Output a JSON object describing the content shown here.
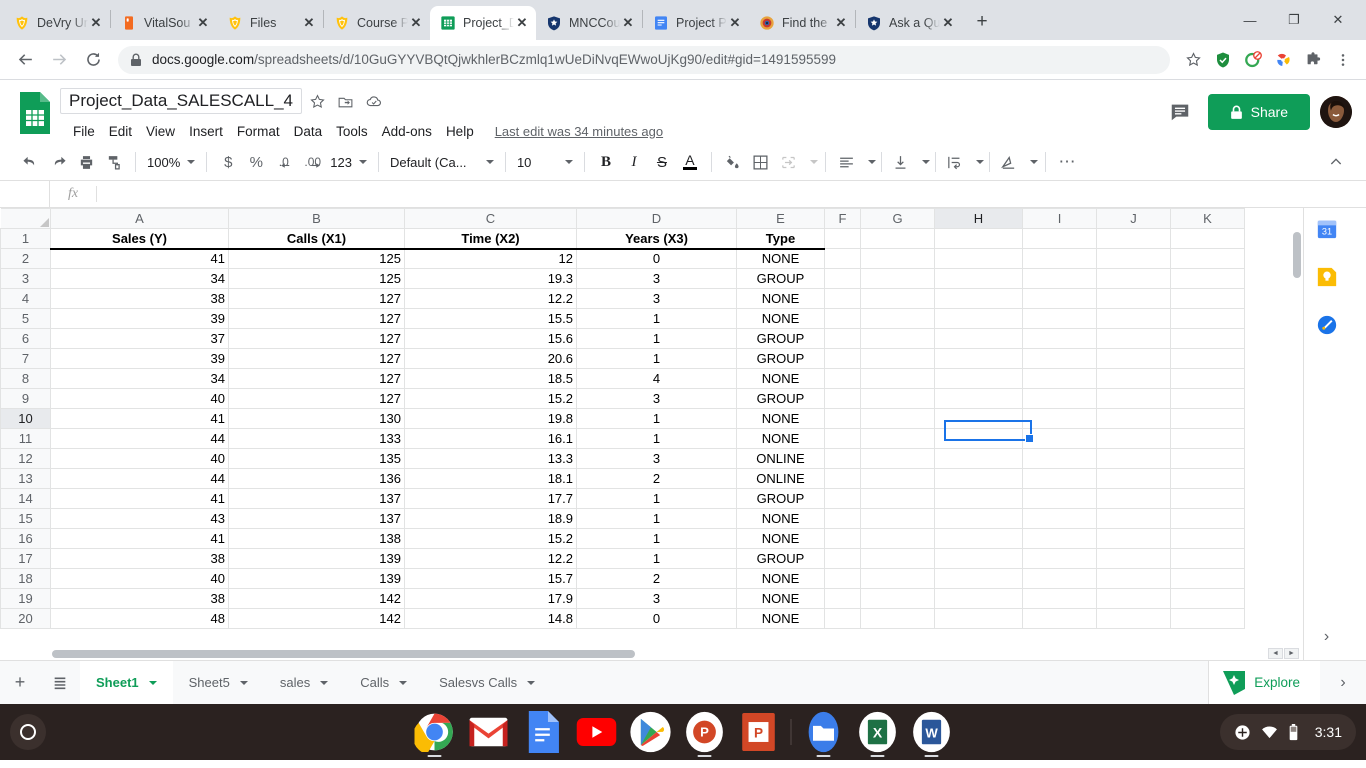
{
  "browser": {
    "tabs": [
      {
        "label": "DeVry Un",
        "icon": "devry-icon",
        "active": false,
        "sep_after": true
      },
      {
        "label": "VitalSou",
        "icon": "vitalsource-icon",
        "active": false,
        "sep_after": false
      },
      {
        "label": "Files",
        "icon": "devry-icon",
        "active": false,
        "sep_after": true
      },
      {
        "label": "Course P",
        "icon": "devry-icon",
        "active": false,
        "sep_after": false
      },
      {
        "label": "Project_D",
        "icon": "sheets-icon",
        "active": true,
        "sep_after": false
      },
      {
        "label": "MNCCou",
        "icon": "shield-icon",
        "active": false,
        "sep_after": true
      },
      {
        "label": "Project P",
        "icon": "docs-icon",
        "active": false,
        "sep_after": false
      },
      {
        "label": "Find the",
        "icon": "globe-icon",
        "active": false,
        "sep_after": true
      },
      {
        "label": "Ask a Qu",
        "icon": "shield-icon",
        "active": false,
        "sep_after": false
      }
    ],
    "new_tab_label": "+",
    "close_label": "✕",
    "window_controls": {
      "minimize": "—",
      "maximize": "❐",
      "close": "✕"
    },
    "nav": {
      "back": "←",
      "forward": "→",
      "reload": "⟳"
    },
    "url_host": "docs.google.com",
    "url_path": "/spreadsheets/d/10GuGYYVBQtQjwkhlerBCzmlq1wUeDiNvqEWwoUjKg90/edit#gid=1491595599",
    "lock_icon": "lock-icon",
    "star_icon": "bookmark-star-icon",
    "extensions": [
      "shield-check-icon",
      "adblock-icon",
      "pinwheel-icon",
      "puzzle-piece-icon"
    ],
    "menu_icon": "three-dot-menu-icon"
  },
  "sheets": {
    "doc_title": "Project_Data_SALESCALL_4",
    "title_icons": [
      "star-icon",
      "move-to-folder-icon",
      "cloud-saved-icon"
    ],
    "menus": [
      "File",
      "Edit",
      "View",
      "Insert",
      "Format",
      "Data",
      "Tools",
      "Add-ons",
      "Help"
    ],
    "last_edit": "Last edit was 34 minutes ago",
    "comment_icon": "comment-history-icon",
    "share_label": "Share",
    "share_lock_icon": "lock-icon",
    "share_color": "#0f9d58",
    "avatar": "user-avatar",
    "toolbar": {
      "undo": "undo-icon",
      "redo": "redo-icon",
      "print": "print-icon",
      "paint_format": "paint-format-icon",
      "zoom": "100%",
      "currency": "$",
      "percent": "%",
      "decrease_decimal": ".0",
      "increase_decimal": ".00",
      "more_formats": "123",
      "font": "Default (Ca...",
      "font_size": "10",
      "bold": "B",
      "italic": "I",
      "strikethrough": "S",
      "text_color": "A",
      "fill_color": "fill-color-icon",
      "borders": "borders-icon",
      "merge_cells": "merge-cells-icon",
      "h_align": "horizontal-align-icon",
      "v_align": "vertical-align-icon",
      "text_wrap": "text-wrap-icon",
      "text_rotation": "text-rotation-icon",
      "more": "⋯",
      "collapse": "^"
    },
    "formula_bar": {
      "fx": "fx",
      "value": ""
    },
    "selected_cell": "H10",
    "columns": [
      "A",
      "B",
      "C",
      "D",
      "E",
      "F",
      "G",
      "H",
      "I",
      "J",
      "K"
    ],
    "header_row": [
      "Sales (Y)",
      "Calls (X1)",
      "Time (X2)",
      "Years (X3)",
      "Type"
    ],
    "rows": [
      {
        "n": "2",
        "cells": [
          "41",
          "125",
          "12",
          "0",
          "NONE"
        ]
      },
      {
        "n": "3",
        "cells": [
          "34",
          "125",
          "19.3",
          "3",
          "GROUP"
        ]
      },
      {
        "n": "4",
        "cells": [
          "38",
          "127",
          "12.2",
          "3",
          "NONE"
        ]
      },
      {
        "n": "5",
        "cells": [
          "39",
          "127",
          "15.5",
          "1",
          "NONE"
        ]
      },
      {
        "n": "6",
        "cells": [
          "37",
          "127",
          "15.6",
          "1",
          "GROUP"
        ]
      },
      {
        "n": "7",
        "cells": [
          "39",
          "127",
          "20.6",
          "1",
          "GROUP"
        ]
      },
      {
        "n": "8",
        "cells": [
          "34",
          "127",
          "18.5",
          "4",
          "NONE"
        ]
      },
      {
        "n": "9",
        "cells": [
          "40",
          "127",
          "15.2",
          "3",
          "GROUP"
        ]
      },
      {
        "n": "10",
        "cells": [
          "41",
          "130",
          "19.8",
          "1",
          "NONE"
        ]
      },
      {
        "n": "11",
        "cells": [
          "44",
          "133",
          "16.1",
          "1",
          "NONE"
        ]
      },
      {
        "n": "12",
        "cells": [
          "40",
          "135",
          "13.3",
          "3",
          "ONLINE"
        ]
      },
      {
        "n": "13",
        "cells": [
          "44",
          "136",
          "18.1",
          "2",
          "ONLINE"
        ]
      },
      {
        "n": "14",
        "cells": [
          "41",
          "137",
          "17.7",
          "1",
          "GROUP"
        ]
      },
      {
        "n": "15",
        "cells": [
          "43",
          "137",
          "18.9",
          "1",
          "NONE"
        ]
      },
      {
        "n": "16",
        "cells": [
          "41",
          "138",
          "15.2",
          "1",
          "NONE"
        ]
      },
      {
        "n": "17",
        "cells": [
          "38",
          "139",
          "12.2",
          "1",
          "GROUP"
        ]
      },
      {
        "n": "18",
        "cells": [
          "40",
          "139",
          "15.7",
          "2",
          "NONE"
        ]
      },
      {
        "n": "19",
        "cells": [
          "38",
          "142",
          "17.9",
          "3",
          "NONE"
        ]
      },
      {
        "n": "20",
        "cells": [
          "48",
          "142",
          "14.8",
          "0",
          "NONE"
        ]
      }
    ],
    "side_rail": [
      "calendar-icon",
      "keep-icon",
      "tasks-icon"
    ],
    "side_rail_expand": "›",
    "sheet_tabs": [
      {
        "label": "Sheet1",
        "active": true
      },
      {
        "label": "Sheet5",
        "active": false
      },
      {
        "label": "sales",
        "active": false
      },
      {
        "label": "Calls",
        "active": false
      },
      {
        "label": "Salesvs Calls",
        "active": false
      }
    ],
    "add_sheet": "+",
    "all_sheets": "all-sheets-icon",
    "explore_label": "Explore",
    "explore_icon": "explore-icon",
    "bottom_chevron": "›",
    "hscroll_left": "◄",
    "hscroll_right": "►"
  },
  "shelf": {
    "launcher": "launcher-icon",
    "apps": [
      {
        "name": "chrome-icon",
        "running": true
      },
      {
        "name": "gmail-icon",
        "running": false
      },
      {
        "name": "docs-icon",
        "running": false
      },
      {
        "name": "youtube-icon",
        "running": false
      },
      {
        "name": "play-store-icon",
        "running": false
      },
      {
        "name": "powerpoint-web-icon",
        "running": true
      },
      {
        "name": "powerpoint-icon",
        "running": false
      },
      {
        "name": "files-icon",
        "running": true
      },
      {
        "name": "excel-icon",
        "running": true
      },
      {
        "name": "word-icon",
        "running": true
      }
    ],
    "tray": {
      "accessibility_icon": "accessibility-icon",
      "wifi_icon": "wifi-icon",
      "battery_icon": "battery-icon",
      "time": "3:31"
    }
  }
}
